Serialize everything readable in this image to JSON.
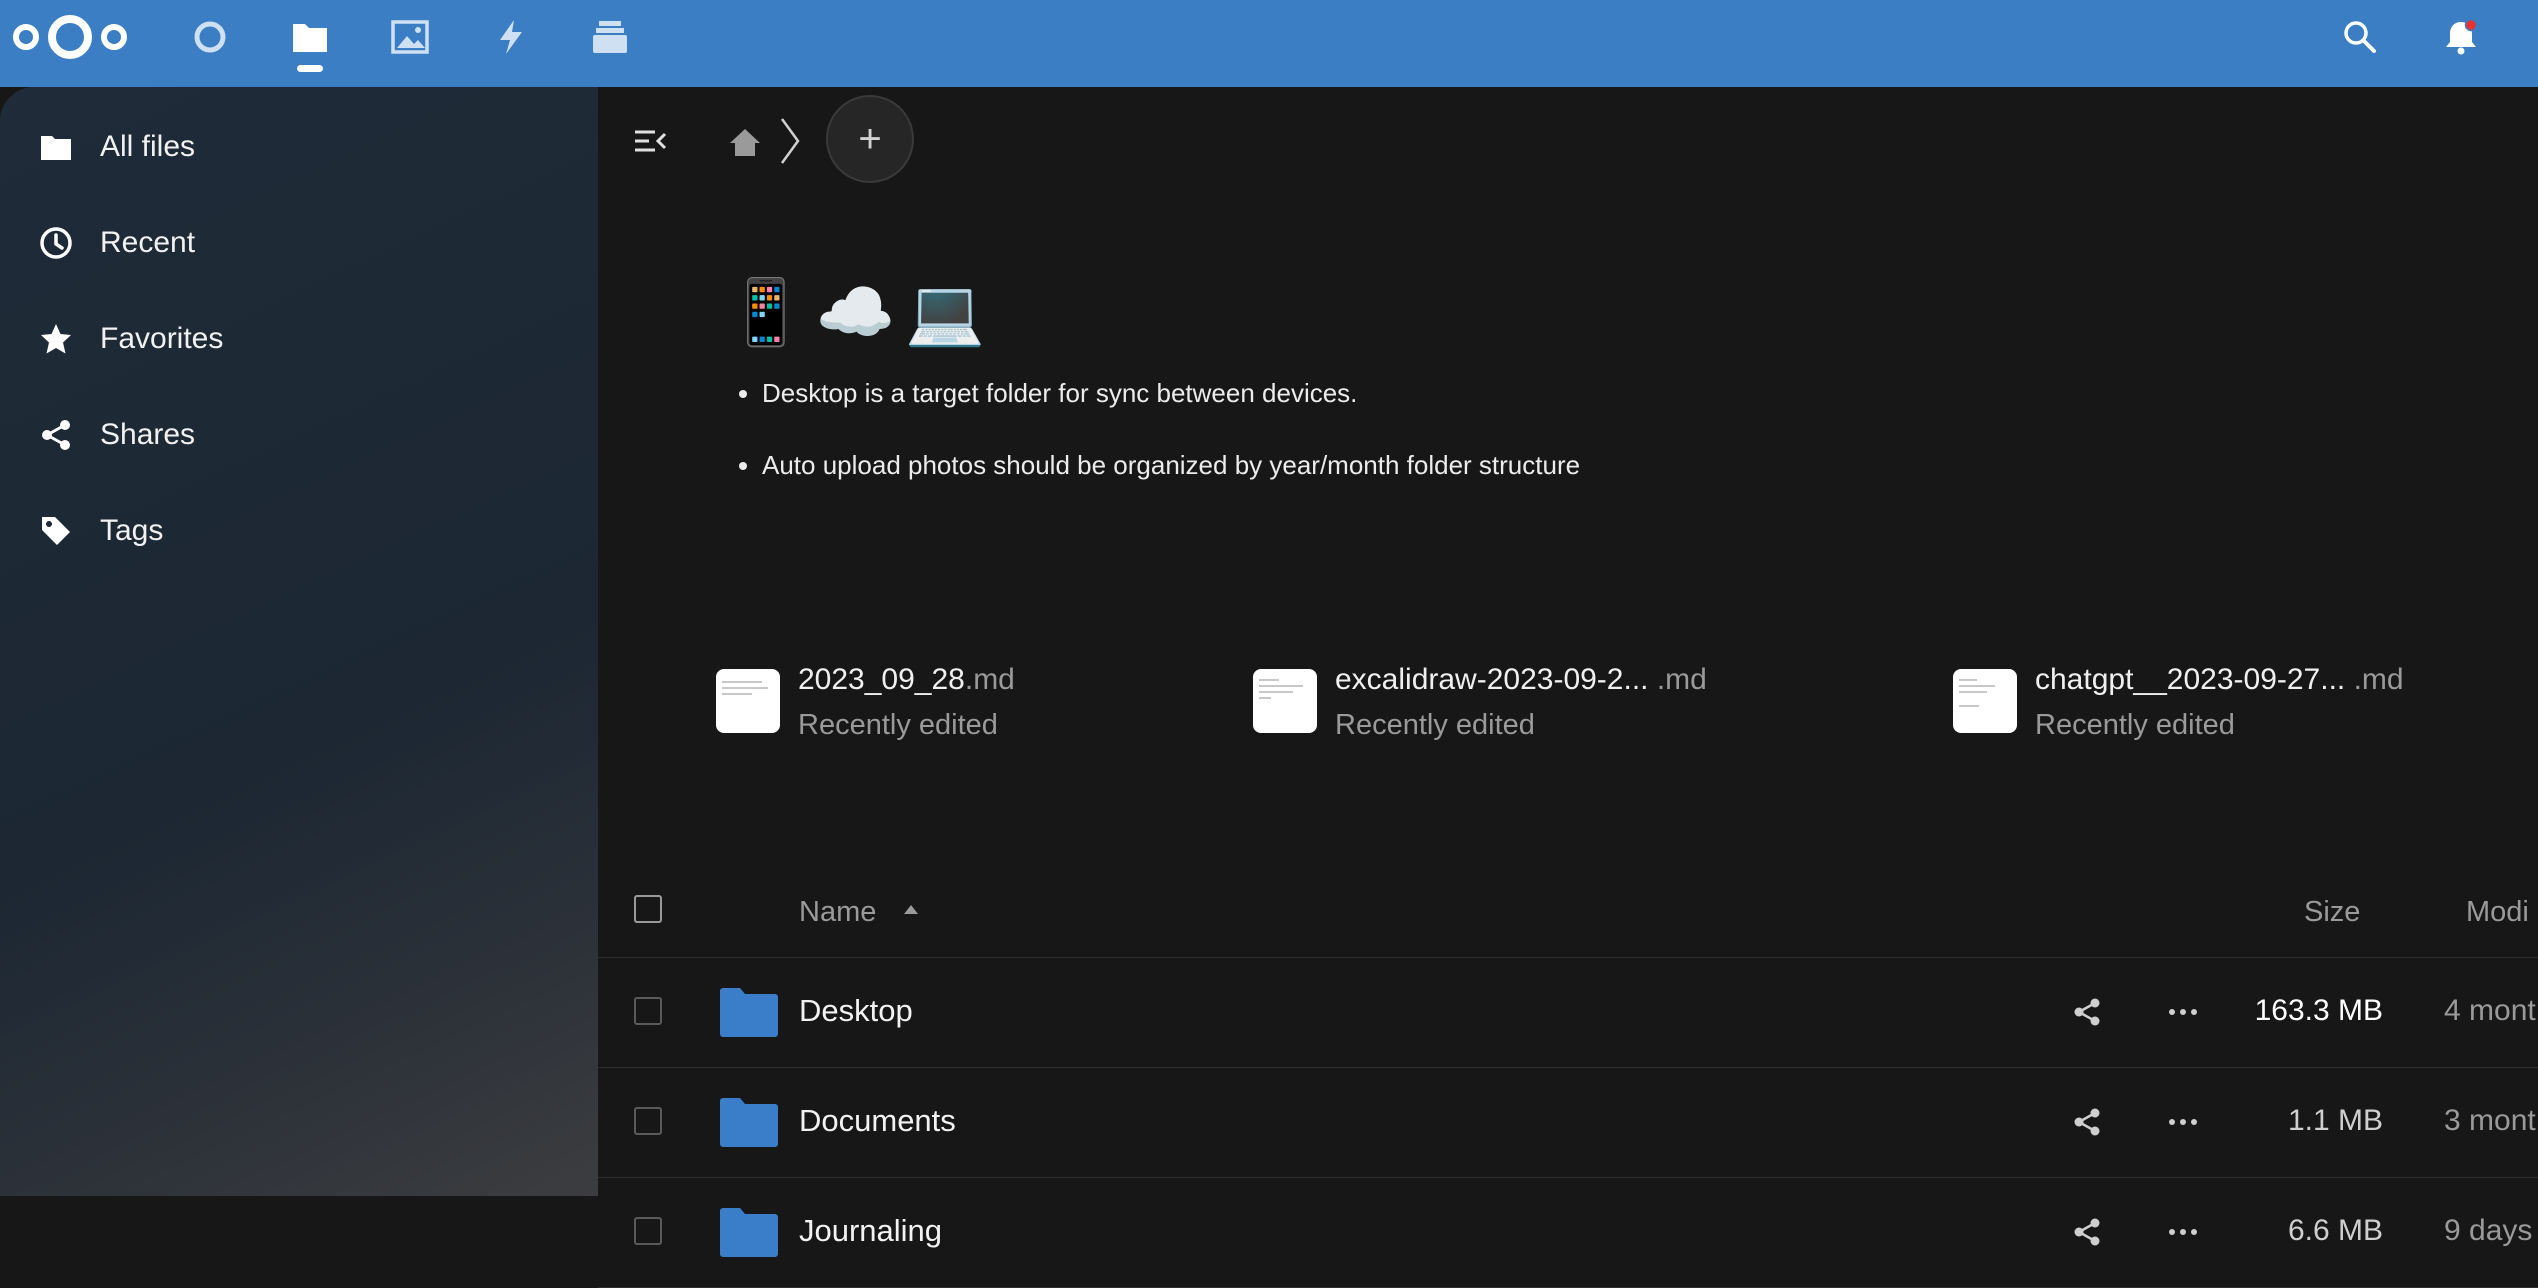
{
  "header": {
    "logo": "nextcloud-logo",
    "apps": [
      {
        "name": "dashboard",
        "icon": "circle-icon"
      },
      {
        "name": "files",
        "icon": "folder-icon",
        "active": true
      },
      {
        "name": "photos",
        "icon": "image-icon"
      },
      {
        "name": "activity",
        "icon": "lightning-icon"
      },
      {
        "name": "deck",
        "icon": "stack-icon"
      }
    ],
    "search_icon": "search-icon",
    "notifications_icon": "bell-icon",
    "colors": {
      "bar": "#3b7ec4",
      "accent": "#3b7ec4",
      "notification_dot": "#e9322d"
    }
  },
  "sidebar": {
    "items": [
      {
        "label": "All files",
        "icon": "folder-icon"
      },
      {
        "label": "Recent",
        "icon": "clock-icon"
      },
      {
        "label": "Favorites",
        "icon": "star-icon"
      },
      {
        "label": "Shares",
        "icon": "share-icon"
      },
      {
        "label": "Tags",
        "icon": "tag-icon"
      }
    ]
  },
  "breadcrumb": {
    "home_icon": "home-icon",
    "new_button_label": "+"
  },
  "readme": {
    "emojis": [
      "📱",
      "☁️",
      "💻"
    ],
    "bullets": [
      "Desktop is a target folder for sync between devices.",
      "Auto upload photos should be organized by year/month folder structure"
    ]
  },
  "recent": [
    {
      "name": "2023_09_28",
      "ext": ".md",
      "subtitle": "Recently edited"
    },
    {
      "name": "excalidraw-2023-09-2...",
      "ext": " .md",
      "subtitle": "Recently edited"
    },
    {
      "name": "chatgpt__2023-09-27...",
      "ext": " .md",
      "subtitle": "Recently edited"
    }
  ],
  "table": {
    "columns": {
      "name": "Name",
      "size": "Size",
      "modified": "Modi"
    },
    "rows": [
      {
        "name": "Desktop",
        "size": "163.3 MB",
        "modified": "4 mont"
      },
      {
        "name": "Documents",
        "size": "1.1 MB",
        "modified": "3 mont"
      },
      {
        "name": "Journaling",
        "size": "6.6 MB",
        "modified": "9 days"
      }
    ]
  }
}
